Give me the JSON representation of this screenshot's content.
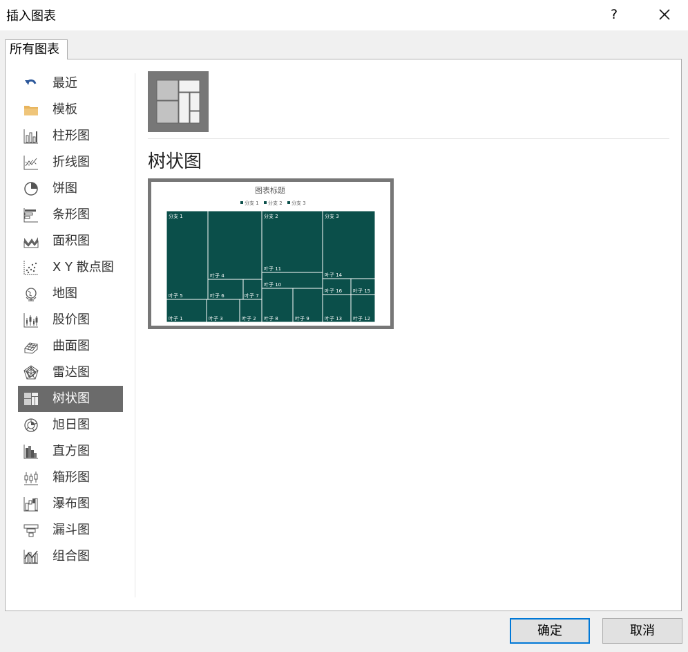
{
  "dialog": {
    "title": "插入图表",
    "help": "?"
  },
  "tab": {
    "label": "所有图表"
  },
  "sidebar": {
    "items": [
      {
        "label": "最近",
        "icon": "recent-undo-icon"
      },
      {
        "label": "模板",
        "icon": "folder-icon"
      },
      {
        "label": "柱形图",
        "icon": "column-chart-icon"
      },
      {
        "label": "折线图",
        "icon": "line-chart-icon"
      },
      {
        "label": "饼图",
        "icon": "pie-chart-icon"
      },
      {
        "label": "条形图",
        "icon": "bar-chart-icon"
      },
      {
        "label": "面积图",
        "icon": "area-chart-icon"
      },
      {
        "label": "X Y 散点图",
        "icon": "scatter-chart-icon"
      },
      {
        "label": "地图",
        "icon": "globe-map-icon"
      },
      {
        "label": "股价图",
        "icon": "stock-chart-icon"
      },
      {
        "label": "曲面图",
        "icon": "surface-chart-icon"
      },
      {
        "label": "雷达图",
        "icon": "radar-chart-icon"
      },
      {
        "label": "树状图",
        "icon": "treemap-icon",
        "selected": true
      },
      {
        "label": "旭日图",
        "icon": "sunburst-icon"
      },
      {
        "label": "直方图",
        "icon": "histogram-icon"
      },
      {
        "label": "箱形图",
        "icon": "box-whisker-icon"
      },
      {
        "label": "瀑布图",
        "icon": "waterfall-icon"
      },
      {
        "label": "漏斗图",
        "icon": "funnel-icon"
      },
      {
        "label": "组合图",
        "icon": "combo-chart-icon"
      }
    ]
  },
  "main": {
    "chart_type_title": "树状图",
    "preview": {
      "title": "图表标题",
      "legend": [
        "分支 1",
        "分支 2",
        "分支 3"
      ],
      "fill_color": "#0b4f4a",
      "branch_labels": [
        "分支 1",
        "分支 2",
        "分支 3"
      ],
      "leaf_labels": [
        "叶子 1",
        "叶子 2",
        "叶子 3",
        "叶子 4",
        "叶子 5",
        "叶子 6",
        "叶子 7",
        "叶子 8",
        "叶子 9",
        "叶子 10",
        "叶子 11",
        "叶子 12",
        "叶子 13",
        "叶子 14",
        "叶子 15",
        "叶子 16"
      ]
    }
  },
  "buttons": {
    "ok": "确定",
    "cancel": "取消"
  },
  "colors": {
    "selected_bg": "#6b6b6b",
    "accent": "#0078d7",
    "icon_blue": "#2b579a",
    "folder": "#e8b45c"
  }
}
